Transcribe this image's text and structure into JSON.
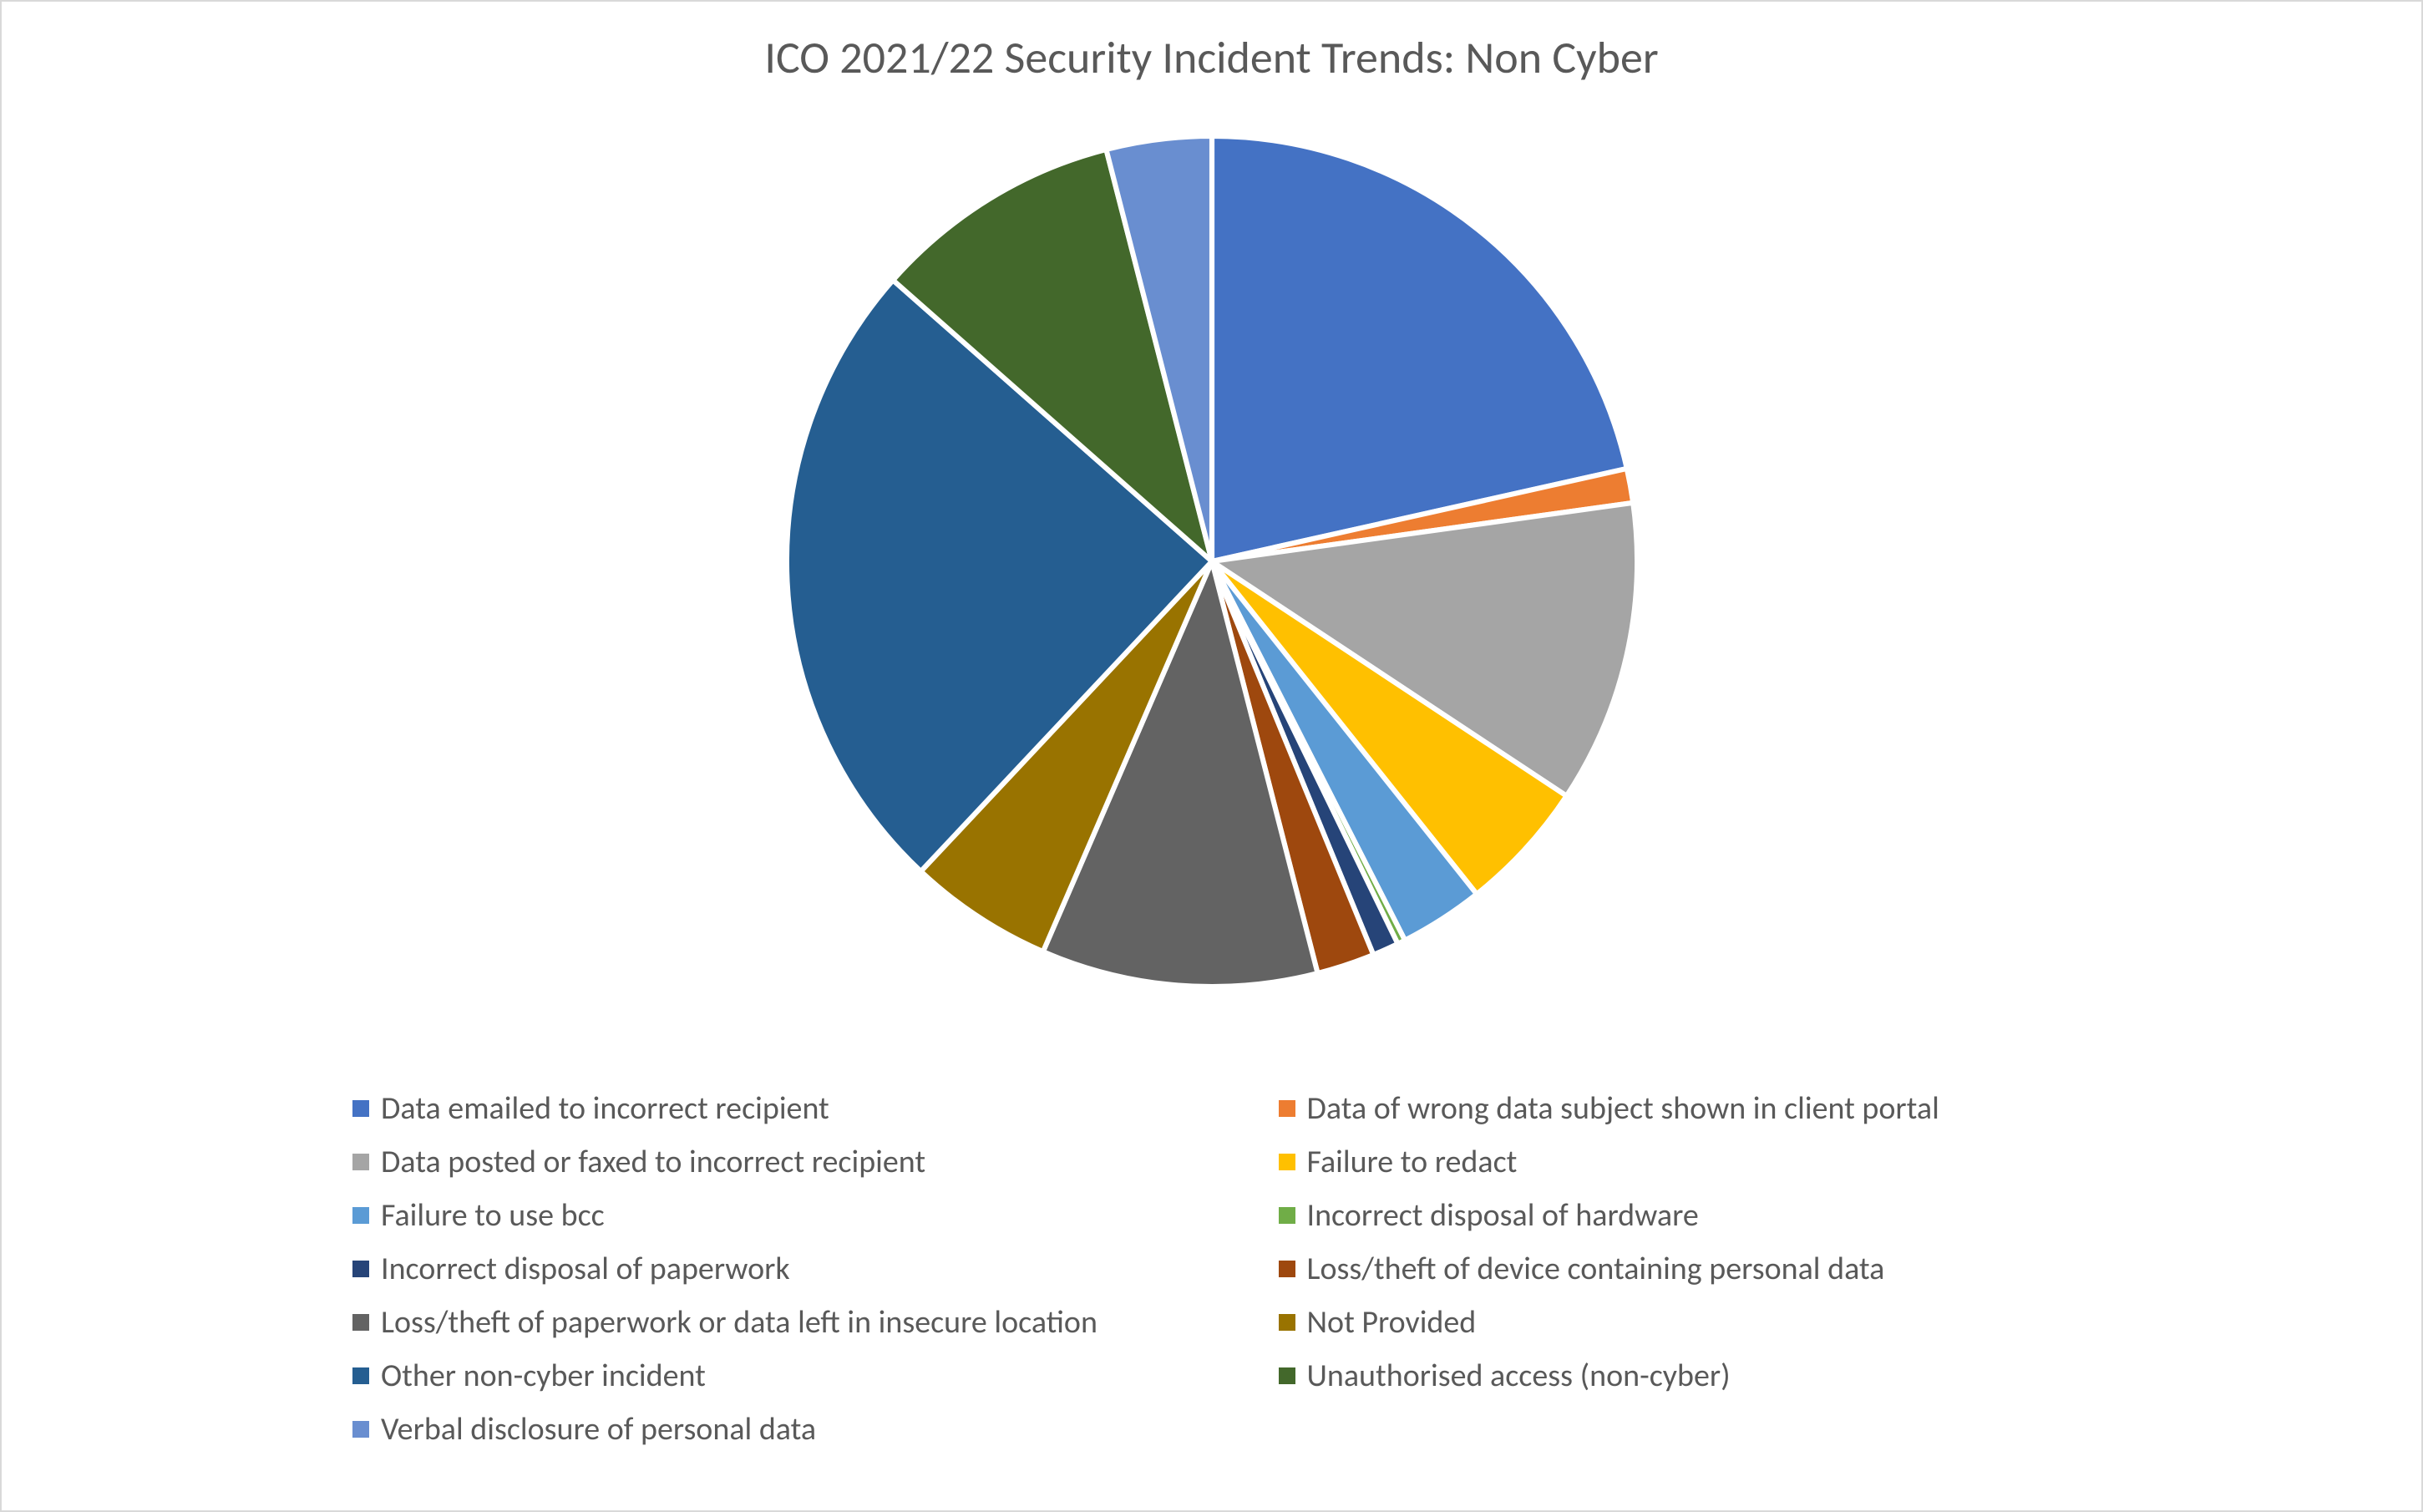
{
  "chart_data": {
    "type": "pie",
    "title": "ICO 2021/22 Security Incident Trends: Non Cyber",
    "series": [
      {
        "name": "Data emailed to incorrect recipient",
        "value": 21.5,
        "color": "#4472c4"
      },
      {
        "name": "Data of wrong data subject shown in client portal",
        "value": 1.3,
        "color": "#ed7d31"
      },
      {
        "name": "Data posted or faxed to incorrect recipient",
        "value": 11.5,
        "color": "#a5a5a5"
      },
      {
        "name": "Failure to redact",
        "value": 5.0,
        "color": "#ffc000"
      },
      {
        "name": "Failure to use bcc",
        "value": 3.2,
        "color": "#5b9bd5"
      },
      {
        "name": "Incorrect disposal of hardware",
        "value": 0.3,
        "color": "#70ad47"
      },
      {
        "name": "Incorrect disposal of paperwork",
        "value": 1.0,
        "color": "#264478"
      },
      {
        "name": "Loss/theft of device containing personal data",
        "value": 2.2,
        "color": "#9e480e"
      },
      {
        "name": "Loss/theft of paperwork or data left in insecure location",
        "value": 10.5,
        "color": "#636363"
      },
      {
        "name": "Not Provided",
        "value": 5.5,
        "color": "#997300"
      },
      {
        "name": "Other non-cyber incident",
        "value": 24.5,
        "color": "#255e91"
      },
      {
        "name": "Unauthorised access (non-cyber)",
        "value": 9.5,
        "color": "#43682b"
      },
      {
        "name": "Verbal disclosure of personal data",
        "value": 4.0,
        "color": "#698ed0"
      }
    ]
  }
}
